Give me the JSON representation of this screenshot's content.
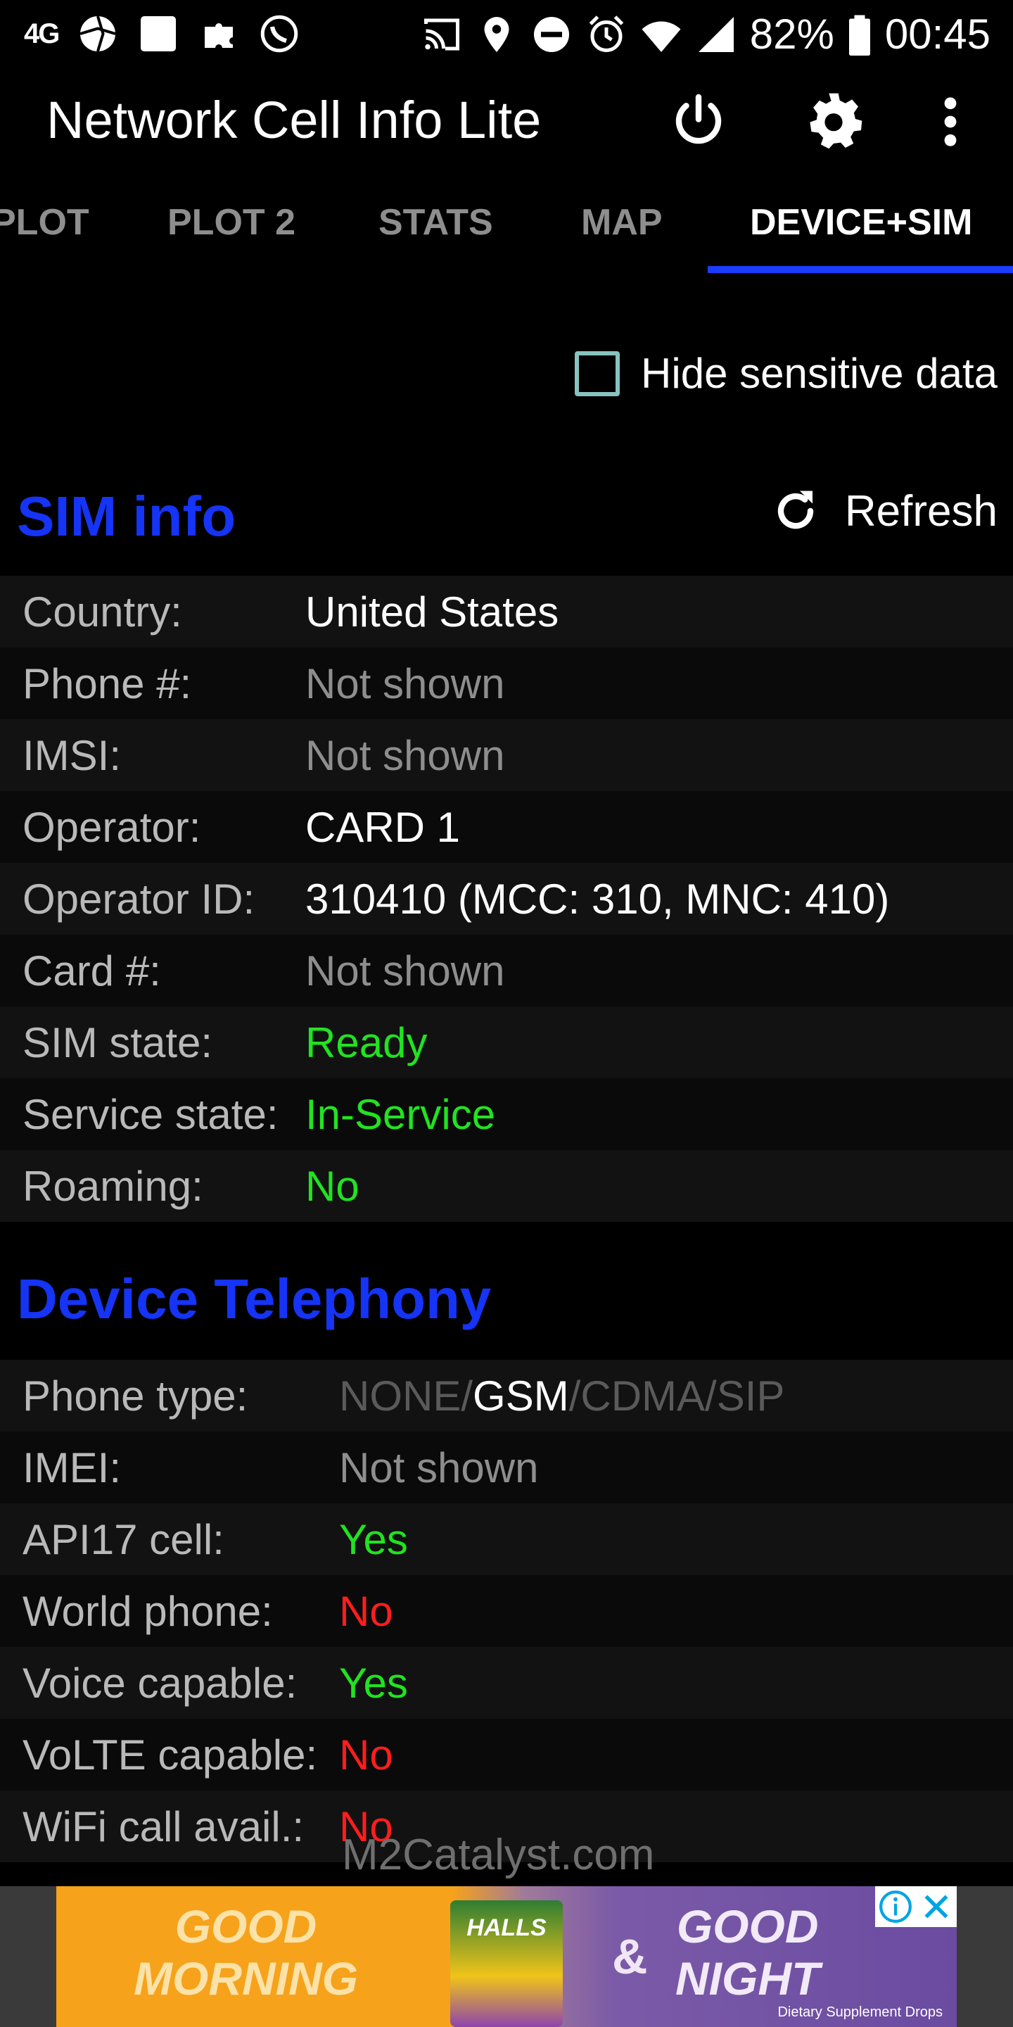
{
  "status_bar": {
    "network_label": "4G",
    "battery_percent": "82%",
    "time": "00:45",
    "icons": [
      "4g-icon",
      "aperture-icon",
      "square-icon",
      "puzzle-icon",
      "whatsapp-icon",
      "cast-icon",
      "location-icon",
      "do-not-disturb-icon",
      "alarm-icon",
      "wifi-icon",
      "signal-icon",
      "battery-icon"
    ]
  },
  "app_bar": {
    "title": "Network Cell Info Lite",
    "actions": [
      "power-icon",
      "gear-icon",
      "more-vert-icon"
    ]
  },
  "tabs": [
    {
      "label": "PLOT",
      "active": false
    },
    {
      "label": "PLOT 2",
      "active": false
    },
    {
      "label": "STATS",
      "active": false
    },
    {
      "label": "MAP",
      "active": false
    },
    {
      "label": "DEVICE+SIM",
      "active": true
    }
  ],
  "hide_sensitive": {
    "label": "Hide sensitive data",
    "checked": false
  },
  "sim_info": {
    "title": "SIM info",
    "refresh_label": "Refresh",
    "rows": [
      {
        "label": "Country:",
        "value": "United States"
      },
      {
        "label": "Phone #:",
        "value": "Not shown"
      },
      {
        "label": "IMSI:",
        "value": "Not shown"
      },
      {
        "label": "Operator:",
        "value": "CARD 1"
      },
      {
        "label": "Operator ID:",
        "value": "310410 (MCC: 310, MNC: 410)"
      },
      {
        "label": "Card #:",
        "value": "Not shown"
      },
      {
        "label": "SIM state:",
        "value": "Ready"
      },
      {
        "label": "Service state:",
        "value": "In-Service"
      },
      {
        "label": "Roaming:",
        "value": "No"
      }
    ]
  },
  "device_telephony": {
    "title": "Device Telephony",
    "phone_type": {
      "label": "Phone type:",
      "parts": [
        "NONE/",
        "GSM",
        "/CDMA/SIP"
      ]
    },
    "rows": [
      {
        "label": "IMEI:",
        "value": "Not shown"
      },
      {
        "label": "API17 cell:",
        "value": "Yes"
      },
      {
        "label": "World phone:",
        "value": "No"
      },
      {
        "label": "Voice capable:",
        "value": "Yes"
      },
      {
        "label": "VoLTE capable:",
        "value": "No"
      },
      {
        "label": "WiFi call avail.:",
        "value": "No"
      }
    ]
  },
  "watermark": "M2Catalyst.com",
  "ad": {
    "left_line1": "GOOD",
    "left_line2": "MORNING",
    "amp": "&",
    "right_line1": "GOOD",
    "right_line2": "NIGHT",
    "product": "HALLS",
    "fine_print": "Dietary Supplement Drops",
    "icons": [
      "info-icon",
      "close-icon"
    ]
  },
  "colors": {
    "accent_blue": "#1534f5",
    "tab_indicator": "#1a3cff",
    "ok_green": "#21e321",
    "bad_red": "#ff1d1d",
    "checkbox_border": "#87c3c0"
  }
}
